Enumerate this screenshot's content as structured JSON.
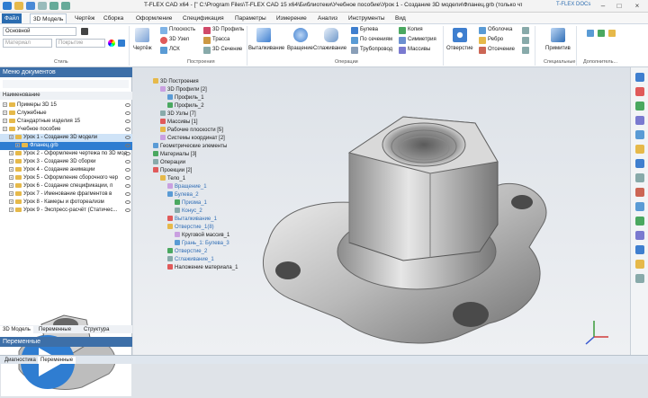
{
  "window": {
    "title": "T-FLEX CAD x64 - [\" C:\\Program Files\\T-FLEX CAD 15 x64\\Библиотеки\\Учебное пособие\\Урок 1 - Создание 3D модели\\Фланец.grb (только чтение)]",
    "docs_label": "T-FLEX DOCs"
  },
  "menu": {
    "items": [
      "Файл",
      "3D Модель",
      "Чертёж",
      "Сборка",
      "Оформление",
      "Спецификация",
      "Параметры",
      "Измерение",
      "Анализ",
      "Инструменты",
      "Вид"
    ]
  },
  "ribbon": {
    "style_group": {
      "label": "Стиль",
      "layer": "Основной",
      "material": "Материал",
      "surface": "Покрытие"
    },
    "build_group": {
      "label": "Построения",
      "sketch": "Чертёж",
      "plane": "Плоскость",
      "node3d": "3D Узел",
      "lsk": "ЛСК",
      "profile3d": "3D Профиль",
      "path": "Трасса",
      "section3d": "3D Сечение"
    },
    "ops_group": {
      "label": "Операции",
      "extrude": "Выталкивание",
      "rotate": "Вращение",
      "smooth": "Сглаживание",
      "boolean": "Булева",
      "by_sections": "По сечениям",
      "pipe": "Трубопровод",
      "copy": "Копия",
      "symmetry": "Симметрия",
      "arrays": "Массивы"
    },
    "hole_group": {
      "hole": "Отверстие",
      "shell": "Оболочка",
      "edge": "Ребро",
      "cut": "Отсечение"
    },
    "special_group": {
      "label": "Специальные",
      "primitives": "Примитив"
    },
    "extra_group": {
      "label": "Дополнитель..."
    }
  },
  "left_panel": {
    "title": "Меню документов",
    "column_header": "Наименование",
    "items": [
      {
        "label": "Примеры 3D 15",
        "level": 0
      },
      {
        "label": "Служебные",
        "level": 0
      },
      {
        "label": "Стандартные изделия 15",
        "level": 0
      },
      {
        "label": "Учебное пособие",
        "level": 0
      },
      {
        "label": "Урок 1 - Создание 3D модели",
        "level": 1
      },
      {
        "label": "Фланец.grb",
        "level": 2
      },
      {
        "label": "Урок 2 - Оформление чертежа по 3D мод",
        "level": 1
      },
      {
        "label": "Урок 3 - Создание 3D сборки",
        "level": 1
      },
      {
        "label": "Урок 4 - Создание анимации",
        "level": 1
      },
      {
        "label": "Урок 5 - Оформление сборочного чер",
        "level": 1
      },
      {
        "label": "Урок 6 - Создание спецификации, п",
        "level": 1
      },
      {
        "label": "Урок 7 - Именование фрагментов в",
        "level": 1
      },
      {
        "label": "Урок 8 - Камеры и фотореализм",
        "level": 1
      },
      {
        "label": "Урок 9 - Экспресс-расчёт (Статичес...",
        "level": 1
      }
    ],
    "bottom_tabs": [
      "3D Модель",
      "Переменные",
      "Структура"
    ],
    "variables_title": "Переменные"
  },
  "model_tree": {
    "items": [
      {
        "label": "3D Построения",
        "level": 0,
        "blue": false
      },
      {
        "label": "3D Профили [2]",
        "level": 1,
        "blue": false
      },
      {
        "label": "Профиль_1",
        "level": 2,
        "blue": false
      },
      {
        "label": "Профиль_2",
        "level": 2,
        "blue": false
      },
      {
        "label": "3D Узлы [7]",
        "level": 1,
        "blue": false
      },
      {
        "label": "Массивы [1]",
        "level": 1,
        "blue": false
      },
      {
        "label": "Рабочие плоскости [5]",
        "level": 1,
        "blue": false
      },
      {
        "label": "Системы координат [2]",
        "level": 1,
        "blue": false
      },
      {
        "label": "Геометрические элементы",
        "level": 0,
        "blue": false
      },
      {
        "label": "Материалы [3]",
        "level": 0,
        "blue": false
      },
      {
        "label": "Операции",
        "level": 0,
        "blue": false
      },
      {
        "label": "Проекции [2]",
        "level": 0,
        "blue": false
      },
      {
        "label": "Тело_1",
        "level": 1,
        "blue": false
      },
      {
        "label": "Вращение_1",
        "level": 2,
        "blue": true
      },
      {
        "label": "Булева_2",
        "level": 2,
        "blue": true
      },
      {
        "label": "Призма_1",
        "level": 3,
        "blue": true
      },
      {
        "label": "Конус_2",
        "level": 3,
        "blue": true
      },
      {
        "label": "Выталкивание_1",
        "level": 2,
        "blue": true
      },
      {
        "label": "Отверстие_1(8)",
        "level": 2,
        "blue": true
      },
      {
        "label": "Круговой массив_1",
        "level": 3,
        "blue": false
      },
      {
        "label": "Грань_1: Булева_3",
        "level": 3,
        "blue": true
      },
      {
        "label": "Отверстие_2",
        "level": 2,
        "blue": true
      },
      {
        "label": "Сглаживание_1",
        "level": 2,
        "blue": true
      },
      {
        "label": "Наложение материала_1",
        "level": 2,
        "blue": false
      }
    ]
  },
  "status": {
    "tabs": [
      "Диагностика",
      "Переменные"
    ]
  },
  "colors": {
    "accent": "#2b6cb0",
    "panel_title": "#3d6fa8",
    "selection": "#2f7dd1"
  }
}
